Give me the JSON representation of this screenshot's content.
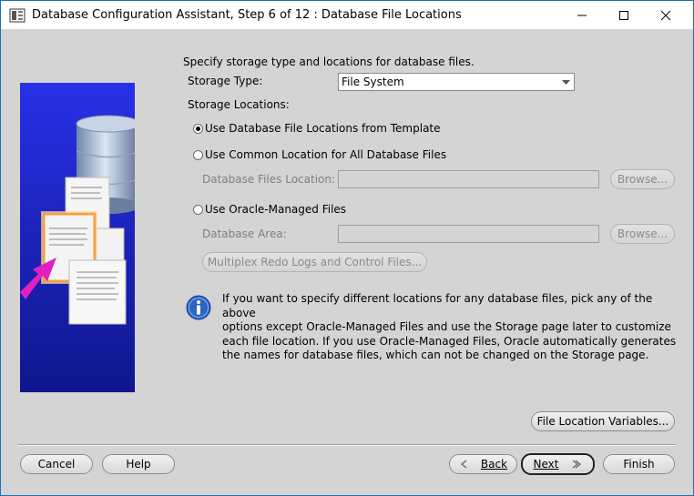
{
  "window": {
    "title": "Database Configuration Assistant, Step 6 of 12 : Database File Locations"
  },
  "content": {
    "intro": "Specify storage type and locations for database files.",
    "storage_type_label": "Storage Type:",
    "storage_type_value": "File System",
    "storage_locations_label": "Storage Locations:",
    "option_template": "Use Database File Locations from Template",
    "option_common": "Use Common Location for All Database Files",
    "db_files_location_label": "Database Files Location:",
    "db_files_location_value": "",
    "browse_label": "Browse...",
    "option_omf": "Use Oracle-Managed Files",
    "db_area_label": "Database Area:",
    "db_area_value": "",
    "multiplex_button": "Multiplex Redo Logs and Control Files...",
    "info_lines": [
      "If you want to specify different locations for any database files, pick any of the above",
      "options except Oracle-Managed Files and use the Storage page later to customize",
      "each file location. If you use Oracle-Managed Files, Oracle automatically generates",
      "the names for database files, which can not be changed on the Storage page."
    ],
    "file_location_variables_button": "File Location Variables..."
  },
  "footer": {
    "cancel": "Cancel",
    "help": "Help",
    "back": "Back",
    "next": "Next",
    "finish": "Finish"
  },
  "colors": {
    "panel_bg": "#d4d4d4",
    "illustration_blue": "#1c22d6",
    "highlight_orange": "#f4a040",
    "arrow_magenta": "#e020c0",
    "info_blue": "#2a64c8"
  }
}
